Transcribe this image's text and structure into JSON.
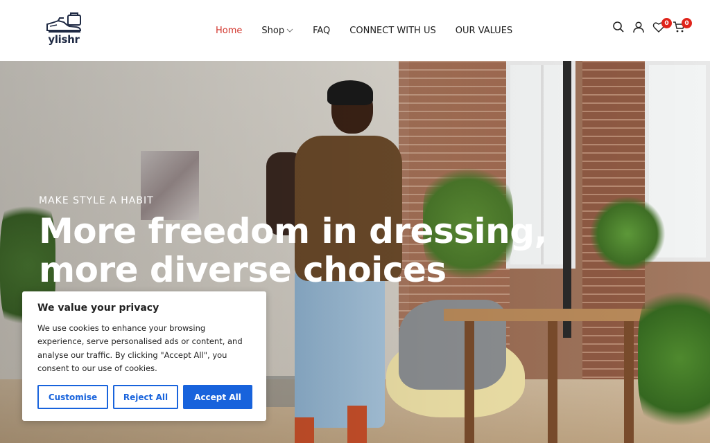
{
  "header": {
    "logo_text": "ylishr",
    "nav": [
      {
        "label": "Home",
        "active": true
      },
      {
        "label": "Shop",
        "has_dropdown": true
      },
      {
        "label": "FAQ"
      },
      {
        "label": "CONNECT WITH US"
      },
      {
        "label": "OUR VALUES"
      }
    ],
    "icons": {
      "search": "search-icon",
      "account": "user-icon",
      "wishlist": "heart-icon",
      "cart": "cart-icon"
    },
    "wishlist_count": "0",
    "cart_count": "0",
    "accent_color": "#d2352c"
  },
  "hero": {
    "kicker": "MAKE STYLE A HABIT",
    "title": "More freedom in dressing, more diverse choices"
  },
  "cookie_banner": {
    "title": "We value your privacy",
    "text": "We use cookies to enhance your browsing experience, serve personalised ads or content, and analyse our traffic. By clicking \"Accept All\", you consent to our use of cookies.",
    "customise_label": "Customise",
    "reject_label": "Reject All",
    "accept_label": "Accept All",
    "button_color": "#1863dc"
  }
}
